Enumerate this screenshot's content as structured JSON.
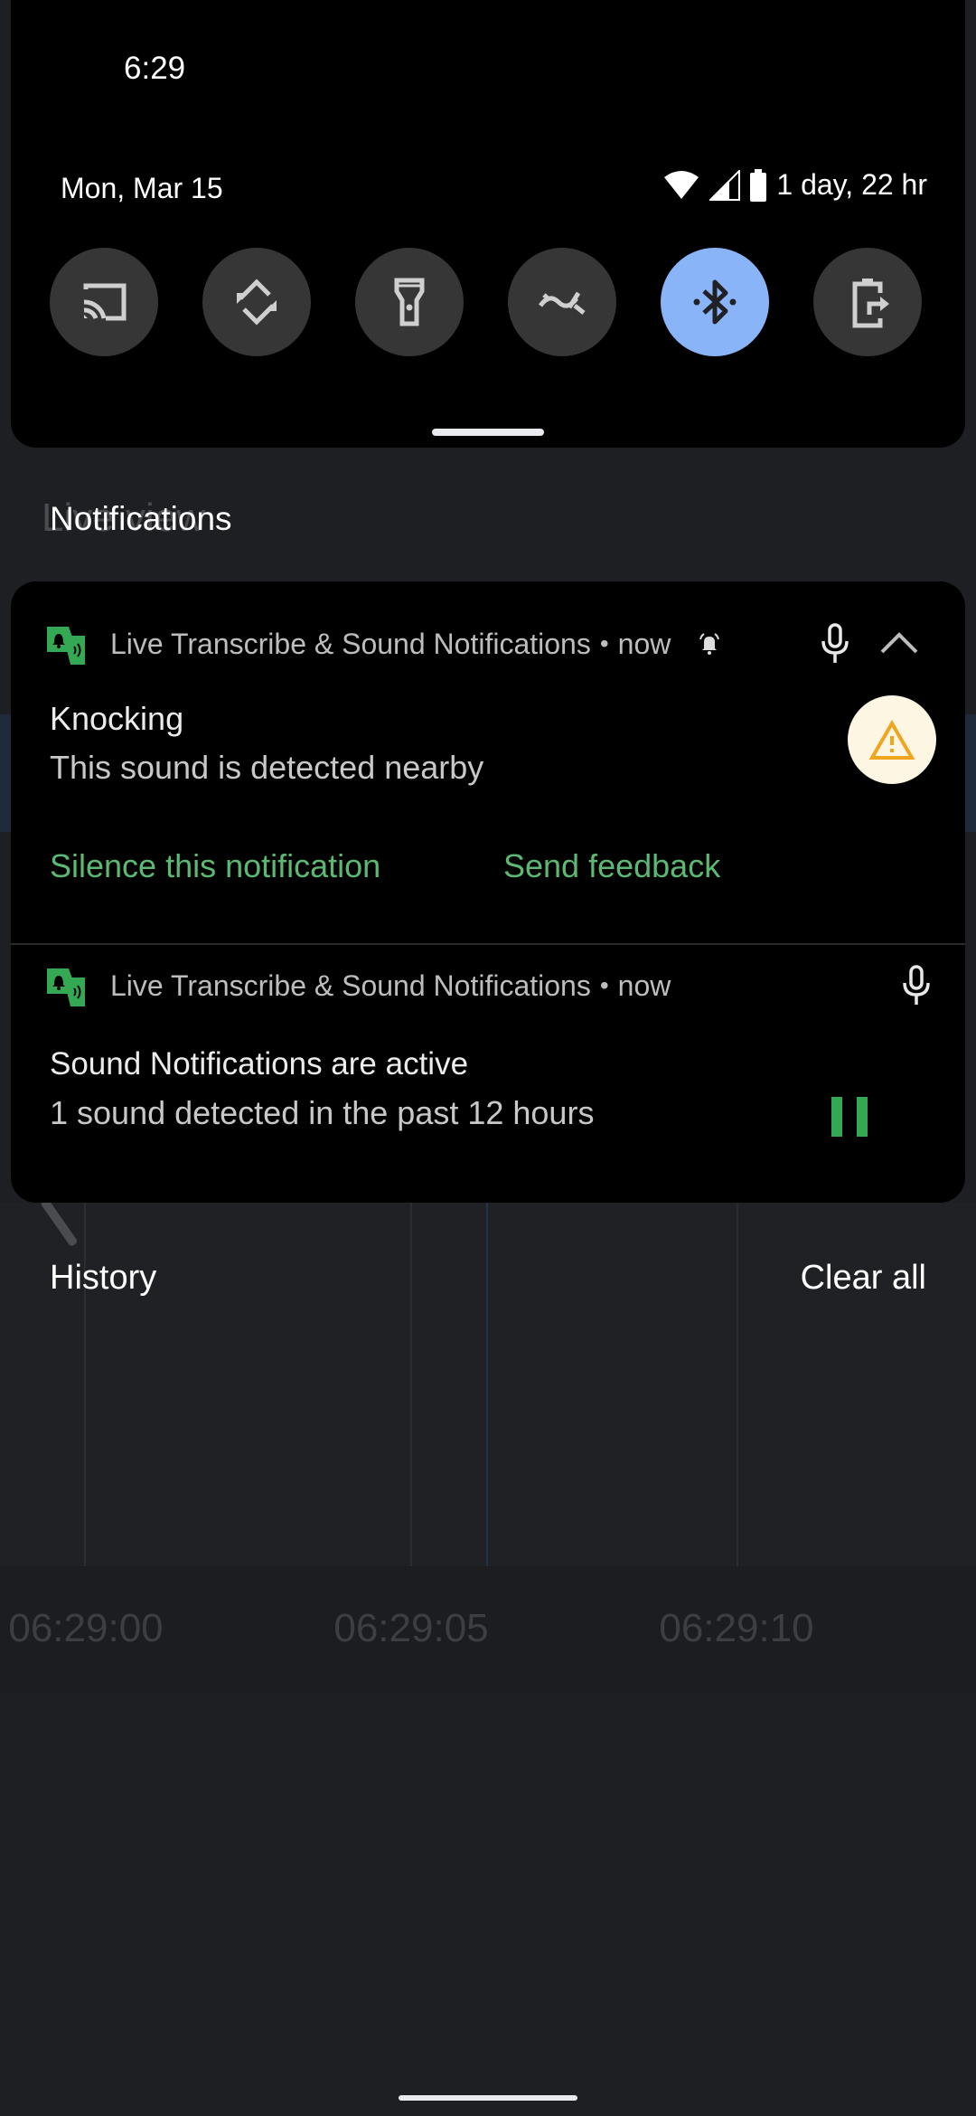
{
  "status_bar": {
    "time": "6:29"
  },
  "quick_settings": {
    "date": "Mon, Mar 15",
    "battery_text": "1 day, 22 hr",
    "status_icons": [
      "wifi-icon",
      "cellular-signal-icon",
      "battery-icon"
    ],
    "tiles": [
      {
        "name": "cast",
        "icon": "cast-icon",
        "active": false
      },
      {
        "name": "auto-rotate",
        "icon": "auto-rotate-icon",
        "active": false
      },
      {
        "name": "flashlight",
        "icon": "flashlight-icon",
        "active": false
      },
      {
        "name": "data-saver",
        "icon": "data-saver-icon",
        "active": false
      },
      {
        "name": "bluetooth",
        "icon": "bluetooth-icon",
        "active": true
      },
      {
        "name": "battery-share",
        "icon": "battery-share-icon",
        "active": false
      }
    ],
    "active_color": "#8ab4f8"
  },
  "background_app": {
    "title": "Live view",
    "time_ticks": [
      "06:29:00",
      "06:29:05",
      "06:29:10"
    ]
  },
  "notifications_header": "Notifications",
  "notifications": [
    {
      "app_name": "Live Transcribe & Sound Notifications",
      "separator": "•",
      "time": "now",
      "title": "Knocking",
      "text": "This sound is detected nearby",
      "actions": [
        "Silence this notification",
        "Send feedback"
      ],
      "badge_icon": "warning-icon"
    },
    {
      "app_name": "Live Transcribe & Sound Notifications",
      "separator": "•",
      "time": "now",
      "title": "Sound Notifications are active",
      "text": "1 sound detected in the past 12 hours",
      "action_icon": "pause-icon"
    }
  ],
  "history_label": "History",
  "clear_all_label": "Clear all",
  "accent_color": "#5bb974"
}
